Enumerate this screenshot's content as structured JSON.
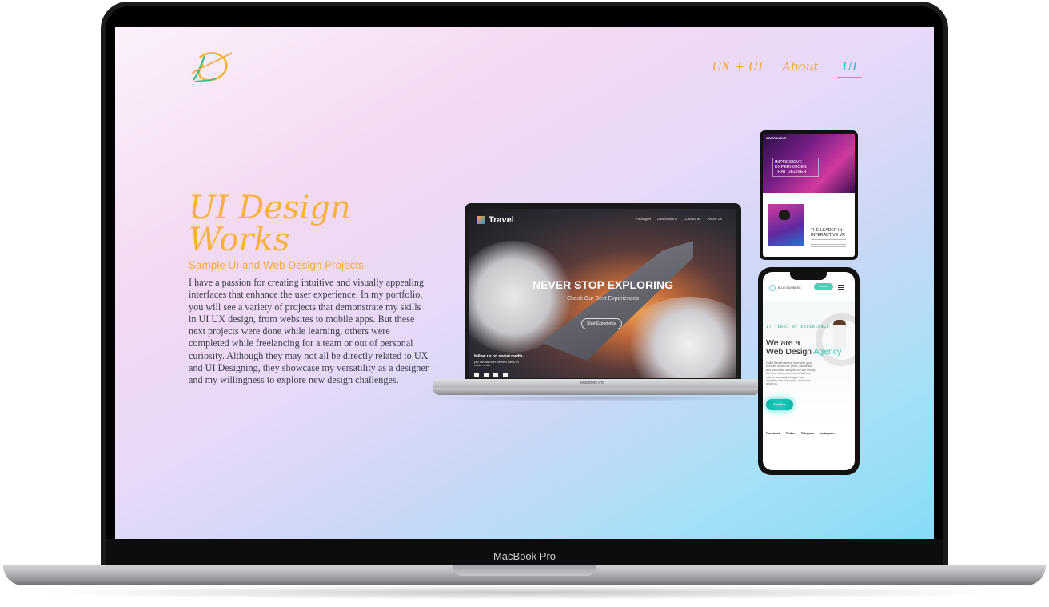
{
  "device": {
    "label": "MacBook Pro"
  },
  "nav": {
    "items": [
      "UX + UI",
      "About",
      "UI"
    ],
    "active_index": 2
  },
  "hero": {
    "title_line1": "UI Design",
    "title_line2": "Works",
    "subtitle": "Sample UI and Web Design Projects",
    "paragraph": "I have a passion for creating intuitive and visually appealing interfaces that enhance the user experience. In my portfolio, you will see a variety of projects that demonstrate my skills in UI UX design, from websites to mobile apps. But these next projects were done while learning, others were completed while freelancing for a team or out of personal curiosity. Although they may not all be directly related to UX and UI Designing, they showcase my versatility as a designer and my willingness to explore new design challenges."
  },
  "mockup_laptop": {
    "brand": "Travel",
    "menu": [
      "Packages",
      "Destinations",
      "Contact us",
      "About Us"
    ],
    "hero": "NEVER STOP EXPLORING",
    "sub": "Check Our Best Experiences",
    "button": "Start Experience",
    "follow": "follow us on social media",
    "follow_sub": "you can discover the best offers on social media",
    "label": "MacBook Pro"
  },
  "mockup_tablet": {
    "brand": "IMMERSIVEVR",
    "hero": "IMPRESSIVE EXPERIENCES THAT DELIVER",
    "lead": "THE LEADER IN INTERACTIVE VR"
  },
  "mockup_phone": {
    "logo": "BLUE BUSINESS",
    "button": "Contact",
    "years": "17 YEARS OF EXPERIENCE",
    "heading_a": "We are a",
    "heading_b": "Web Design",
    "heading_c": "Agency",
    "desc": "Dolful Blus Business have with good services known for great, interactive and innovative designs. We are mostly the best. More references? Ask our clients, famously though, have anything, see our works, and more about us.",
    "cta": "Start Now",
    "social": [
      "Facebook",
      "Twitter",
      "Telegram",
      "Instagram"
    ]
  },
  "colors": {
    "accent": "#f4a937",
    "teal": "#2fc4b6",
    "text": "#3e3e48"
  }
}
